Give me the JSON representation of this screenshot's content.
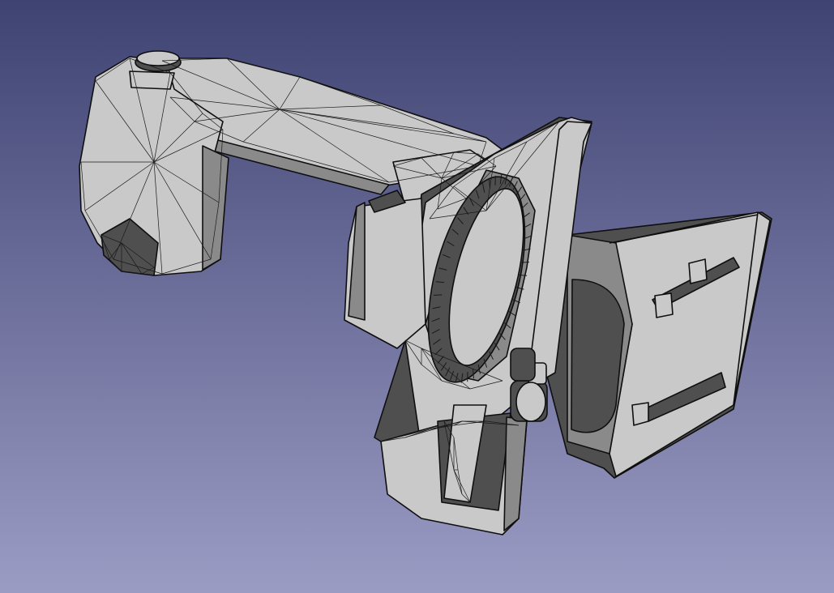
{
  "viewport": {
    "name": "3D view",
    "background_top": "#3f4372",
    "background_bottom": "#9b9cc4"
  },
  "model": {
    "fill": "#c9c9c9",
    "fill_dark": "#8a8a8a",
    "fill_shadow": "#4f4f4f",
    "edge_color": "#0f0f0f",
    "mesh_color": "#1a1a1a"
  }
}
